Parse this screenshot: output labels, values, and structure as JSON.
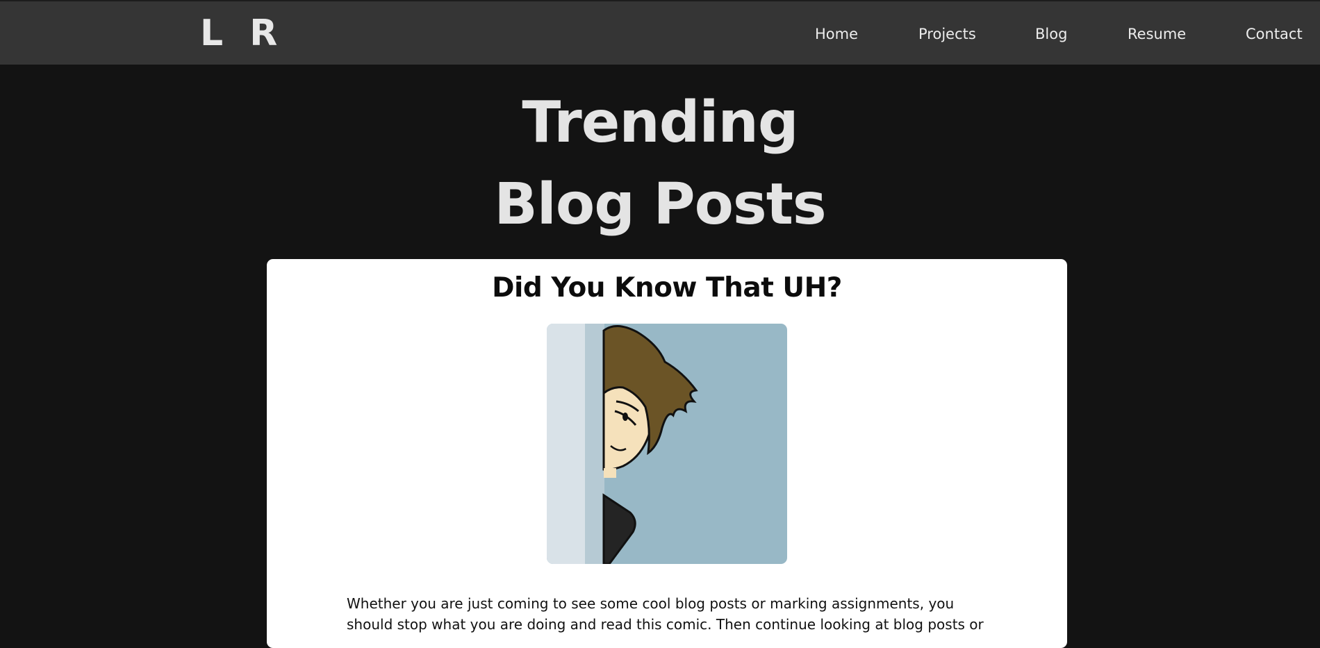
{
  "logo": "L R",
  "nav": {
    "items": [
      {
        "label": "Home"
      },
      {
        "label": "Projects"
      },
      {
        "label": "Blog"
      },
      {
        "label": "Resume"
      },
      {
        "label": "Contact"
      }
    ]
  },
  "hero": {
    "title_line1": "Trending",
    "title_line2": "Blog Posts"
  },
  "post": {
    "title": "Did You Know That UH?",
    "image_icon": "comic-peeking-character",
    "excerpt": "Whether you are just coming to see some cool blog posts or marking assignments, you should stop what you are doing and read this comic. Then continue looking at blog posts or"
  },
  "colors": {
    "background": "#131313",
    "navbar": "#353535",
    "card": "#ffffff",
    "text_light": "#e4e4e4",
    "text_dark": "#0c0c0c"
  }
}
